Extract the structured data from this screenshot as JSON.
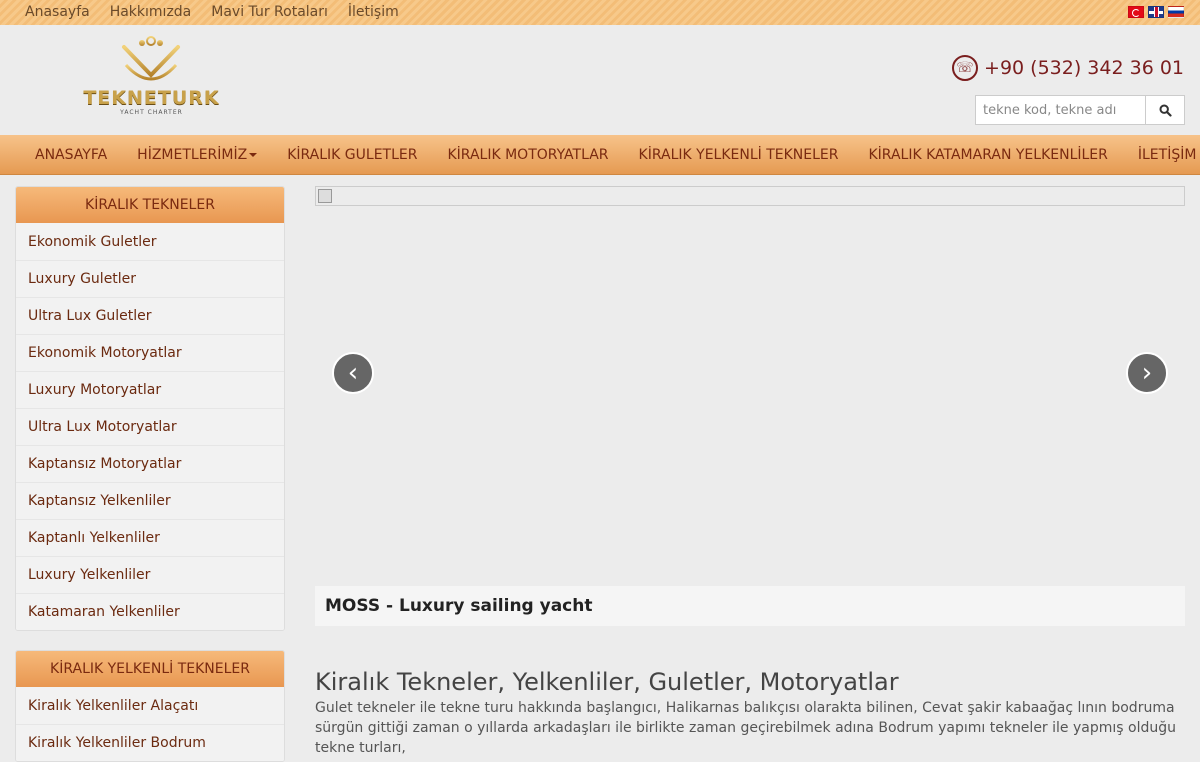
{
  "top_nav": [
    "Anasayfa",
    "Hakkımızda",
    "Mavi Tur Rotaları",
    "İletişim"
  ],
  "flags": [
    "tr",
    "uk",
    "ru"
  ],
  "logo": {
    "name": "TEKNETURK",
    "tagline": "YACHT CHARTER"
  },
  "phone": "+90 (532) 342 36 01",
  "search": {
    "placeholder": "tekne kod, tekne adı"
  },
  "main_nav": {
    "home": "ANASAYFA",
    "services": "HİZMETLERİMİZ",
    "gulets": "KİRALIK GULETLER",
    "motoryachts": "KİRALIK MOTORYATLAR",
    "sailboats": "KİRALIK YELKENLİ TEKNELER",
    "catamarans": "KİRALIK KATAMARAN YELKENLİLER",
    "contact": "İLETİŞİM"
  },
  "sidebar": {
    "panel1": {
      "title": "KİRALIK TEKNELER",
      "items": [
        "Ekonomik Guletler",
        "Luxury Guletler",
        "Ultra Lux Guletler",
        "Ekonomik Motoryatlar",
        "Luxury Motoryatlar",
        "Ultra Lux Motoryatlar",
        "Kaptansız Motoryatlar",
        "Kaptansız Yelkenliler",
        "Kaptanlı Yelkenliler",
        "Luxury Yelkenliler",
        "Katamaran Yelkenliler"
      ]
    },
    "panel2": {
      "title": "KİRALIK YELKENLİ TEKNELER",
      "items": [
        "Kiralık Yelkenliler Alaçatı",
        "Kiralık Yelkenliler Bodrum"
      ]
    }
  },
  "slider": {
    "caption": "MOSS - Luxury sailing yacht",
    "prev": "‹",
    "next": "›"
  },
  "content": {
    "heading": "Kiralık Tekneler, Yelkenliler, Guletler, Motoryatlar",
    "paragraph": "Gulet tekneler ile tekne turu hakkında başlangıcı, Halikarnas balıkçısı olarakta bilinen, Cevat şakir kabaağaç lının bodruma sürgün gittiği zaman o yıllarda arkadaşları ile birlikte zaman geçirebilmek adına Bodrum yapımı tekneler ile yapmış olduğu tekne turları,"
  }
}
